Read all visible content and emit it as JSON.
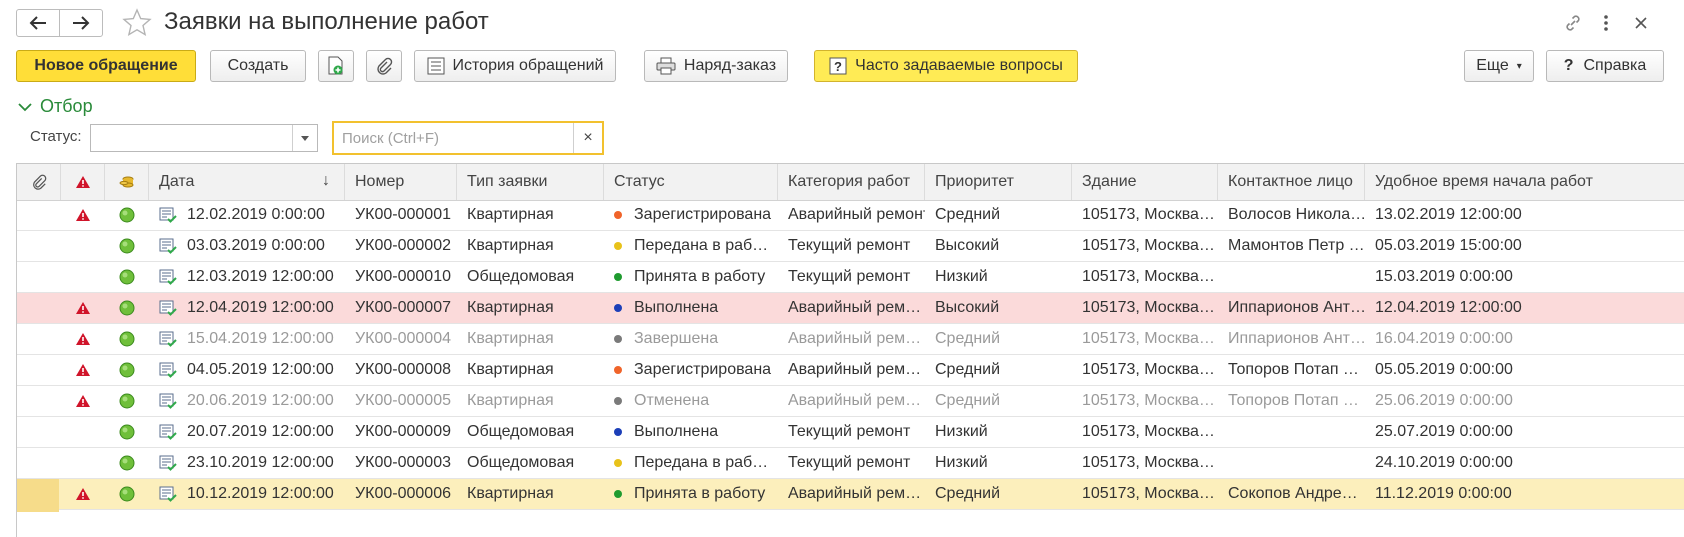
{
  "window": {
    "title": "Заявки на выполнение работ",
    "icons": [
      "back-arrow-icon",
      "forward-arrow-icon",
      "star-icon",
      "link-icon",
      "more-icon",
      "close-icon"
    ]
  },
  "toolbar": {
    "new_request": "Новое обращение",
    "create": "Создать",
    "history": "История обращений",
    "work_order": "Наряд-заказ",
    "faq": "Часто задаваемые вопросы",
    "more": "Еще",
    "help": "Справка"
  },
  "filter": {
    "section_label": "Отбор",
    "status_label": "Статус:",
    "status_value": "",
    "search_placeholder": "Поиск (Ctrl+F)"
  },
  "table": {
    "columns": [
      "Дата",
      "Номер",
      "Тип заявки",
      "Статус",
      "Категория работ",
      "Приоритет",
      "Здание",
      "Контактное лицо",
      "Удобное время начала работ"
    ],
    "status_colors": {
      "Зарегистрирована": "#f0642a",
      "Передана в работу": "#e8c21a",
      "Принята в работу": "#1f9b2f",
      "Выполнена": "#1c3fb8",
      "Завершена": "#7a7a7a",
      "Отменена": "#7a7a7a"
    },
    "rows": [
      {
        "warn": true,
        "date": "12.02.2019 0:00:00",
        "number": "УК00-000001",
        "type": "Квартирная",
        "status": "Зарегистрирована",
        "status_color": "#f0642a",
        "category": "Аварийный ремонт",
        "priority": "Средний",
        "building": "105173, Москва…",
        "contact": "Волосов Никола…",
        "start": "13.02.2019 12:00:00",
        "style": ""
      },
      {
        "warn": false,
        "date": "03.03.2019 0:00:00",
        "number": "УК00-000002",
        "type": "Квартирная",
        "status": "Передана в раб…",
        "status_color": "#e8c21a",
        "category": "Текущий ремонт",
        "priority": "Высокий",
        "building": "105173, Москва…",
        "contact": "Мамонтов Петр …",
        "start": "05.03.2019 15:00:00",
        "style": ""
      },
      {
        "warn": false,
        "date": "12.03.2019 12:00:00",
        "number": "УК00-000010",
        "type": "Общедомовая",
        "status": "Принята в работу",
        "status_color": "#1f9b2f",
        "category": "Текущий ремонт",
        "priority": "Низкий",
        "building": "105173, Москва…",
        "contact": "",
        "start": "15.03.2019 0:00:00",
        "style": ""
      },
      {
        "warn": true,
        "date": "12.04.2019 12:00:00",
        "number": "УК00-000007",
        "type": "Квартирная",
        "status": "Выполнена",
        "status_color": "#1c3fb8",
        "category": "Аварийный рем…",
        "priority": "Высокий",
        "building": "105173, Москва…",
        "contact": "Иппарионов Ант…",
        "start": "12.04.2019 12:00:00",
        "style": "pink"
      },
      {
        "warn": true,
        "date": "15.04.2019 12:00:00",
        "number": "УК00-000004",
        "type": "Квартирная",
        "status": "Завершена",
        "status_color": "#7a7a7a",
        "category": "Аварийный рем…",
        "priority": "Средний",
        "building": "105173, Москва…",
        "contact": "Иппарионов Ант…",
        "start": "16.04.2019 0:00:00",
        "style": "muted"
      },
      {
        "warn": true,
        "date": "04.05.2019 12:00:00",
        "number": "УК00-000008",
        "type": "Квартирная",
        "status": "Зарегистрирована",
        "status_color": "#f0642a",
        "category": "Аварийный рем…",
        "priority": "Средний",
        "building": "105173, Москва…",
        "contact": "Топоров Потап …",
        "start": "05.05.2019 0:00:00",
        "style": ""
      },
      {
        "warn": true,
        "date": "20.06.2019 12:00:00",
        "number": "УК00-000005",
        "type": "Квартирная",
        "status": "Отменена",
        "status_color": "#7a7a7a",
        "category": "Аварийный рем…",
        "priority": "Средний",
        "building": "105173, Москва…",
        "contact": "Топоров Потап …",
        "start": "25.06.2019 0:00:00",
        "style": "muted"
      },
      {
        "warn": false,
        "date": "20.07.2019 12:00:00",
        "number": "УК00-000009",
        "type": "Общедомовая",
        "status": "Выполнена",
        "status_color": "#1c3fb8",
        "category": "Текущий ремонт",
        "priority": "Низкий",
        "building": "105173, Москва…",
        "contact": "",
        "start": "25.07.2019 0:00:00",
        "style": ""
      },
      {
        "warn": false,
        "date": "23.10.2019 12:00:00",
        "number": "УК00-000003",
        "type": "Общедомовая",
        "status": "Передана в раб…",
        "status_color": "#e8c21a",
        "category": "Текущий ремонт",
        "priority": "Низкий",
        "building": "105173, Москва…",
        "contact": "",
        "start": "24.10.2019 0:00:00",
        "style": ""
      },
      {
        "warn": true,
        "date": "10.12.2019 12:00:00",
        "number": "УК00-000006",
        "type": "Квартирная",
        "status": "Принята в работу",
        "status_color": "#1f9b2f",
        "category": "Аварийный рем…",
        "priority": "Средний",
        "building": "105173, Москва…",
        "contact": "Сокопов Андре…",
        "start": "11.12.2019 0:00:00",
        "style": "sel"
      }
    ]
  }
}
